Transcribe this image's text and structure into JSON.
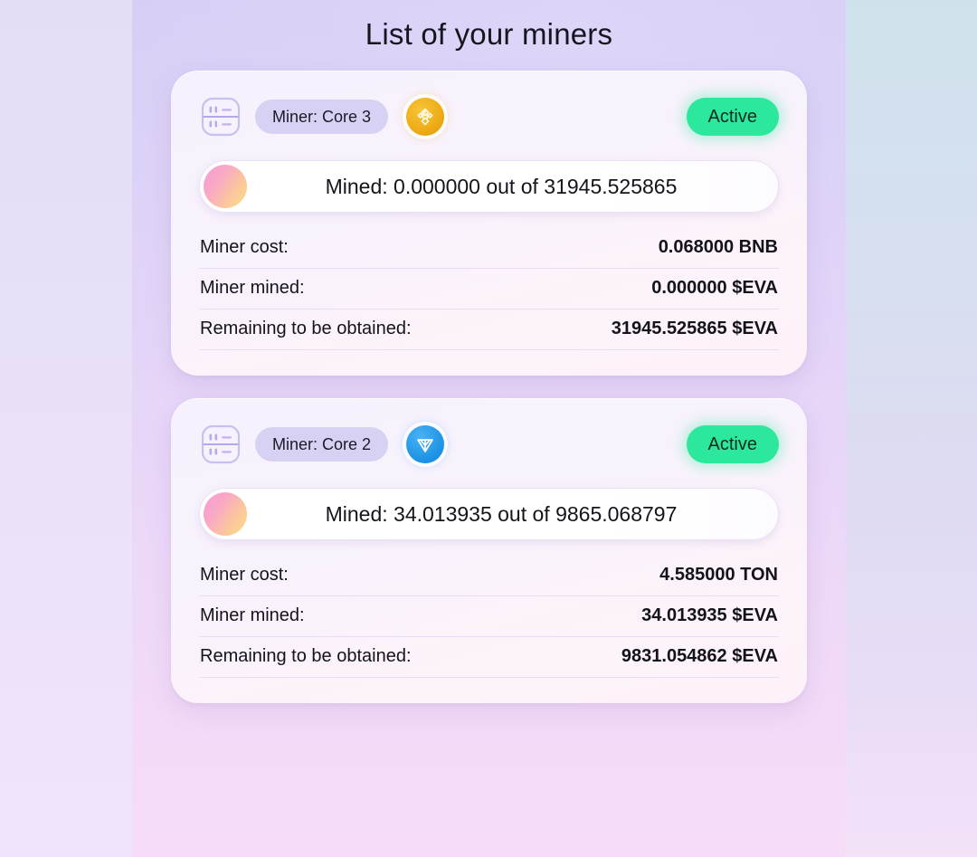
{
  "page": {
    "title": "List of your miners",
    "accent_green": "#2ce89c",
    "pill_purple": "#d7d2f4",
    "bnb_gold": "#eeab16",
    "ton_blue": "#2196e6"
  },
  "miners": [
    {
      "server_icon": "server-rack-icon",
      "name": "Miner: Core 3",
      "coin_icon": "bnb-coin-icon",
      "coin_symbol": "BNB",
      "status": "Active",
      "mined_summary": "Mined: 0.000000 out of 31945.525865",
      "progress_dot": "gradient-dot-icon",
      "rows": [
        {
          "label": "Miner cost:",
          "value": "0.068000 BNB"
        },
        {
          "label": "Miner mined:",
          "value": "0.000000 $EVA"
        },
        {
          "label": "Remaining to be obtained:",
          "value": "31945.525865 $EVA"
        }
      ]
    },
    {
      "server_icon": "server-rack-icon",
      "name": "Miner: Core 2",
      "coin_icon": "ton-coin-icon",
      "coin_symbol": "TON",
      "status": "Active",
      "mined_summary": "Mined: 34.013935 out of 9865.068797",
      "progress_dot": "gradient-dot-icon",
      "rows": [
        {
          "label": "Miner cost:",
          "value": "4.585000 TON"
        },
        {
          "label": "Miner mined:",
          "value": "34.013935 $EVA"
        },
        {
          "label": "Remaining to be obtained:",
          "value": "9831.054862 $EVA"
        }
      ]
    }
  ]
}
